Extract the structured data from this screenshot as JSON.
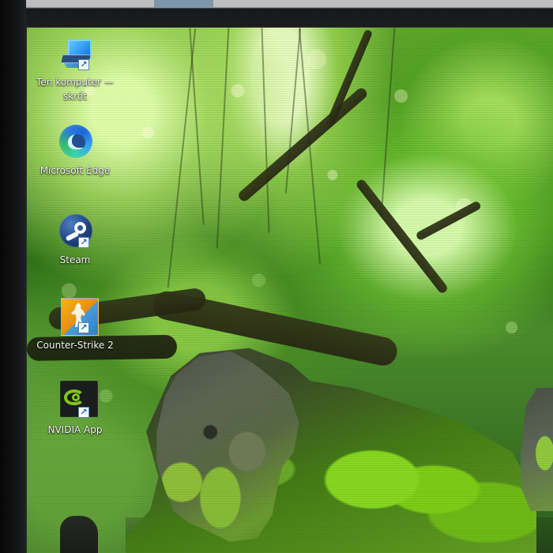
{
  "desktop": {
    "icons": [
      {
        "label": "Ten komputer —\nskrót",
        "icon": "computer-icon",
        "shortcut": true
      },
      {
        "label": "Microsoft Edge",
        "icon": "edge-icon",
        "shortcut": false
      },
      {
        "label": "Steam",
        "icon": "steam-icon",
        "shortcut": true
      },
      {
        "label": "Counter-Strike 2",
        "icon": "counter-strike-2-icon",
        "shortcut": true
      },
      {
        "label": "NVIDIA App",
        "icon": "nvidia-app-icon",
        "shortcut": true
      }
    ]
  },
  "colors": {
    "icon_text": "#f7f7f7",
    "monitor_bezel": "#151617",
    "wallpaper_green": "#4b8d2c"
  }
}
